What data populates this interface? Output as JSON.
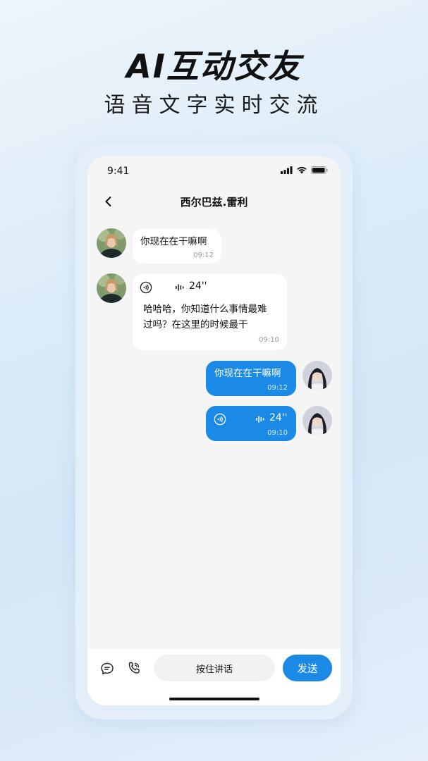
{
  "hero": {
    "title": "AI互动交友",
    "subtitle": "语音文字实时交流"
  },
  "status_bar": {
    "time": "9:41"
  },
  "header": {
    "title": "西尔巴兹.雷利"
  },
  "messages": [
    {
      "side": "in",
      "type": "text",
      "text": "你现在在干嘛啊",
      "time": "09:12"
    },
    {
      "side": "in",
      "type": "voice",
      "duration": "24''",
      "transcript_line1": "哈哈哈，你知道什么事情最难",
      "transcript_line2": "过吗？在这里的时候最干",
      "time": "09:10"
    },
    {
      "side": "out",
      "type": "text",
      "text": "你现在在干嘛啊",
      "time": "09:12"
    },
    {
      "side": "out",
      "type": "voice",
      "duration": "24''",
      "time": "09:10"
    }
  ],
  "bottom_bar": {
    "hold_to_talk": "按住讲话",
    "send": "发送"
  },
  "colors": {
    "accent": "#1a8ae6",
    "incoming_bubble": "#ffffff",
    "screen_bg": "#f5f5f5"
  },
  "icons": [
    "back-icon",
    "signal-icon",
    "wifi-icon",
    "battery-icon",
    "voice-play-icon",
    "waveform-icon",
    "chat-icon",
    "phone-icon"
  ]
}
